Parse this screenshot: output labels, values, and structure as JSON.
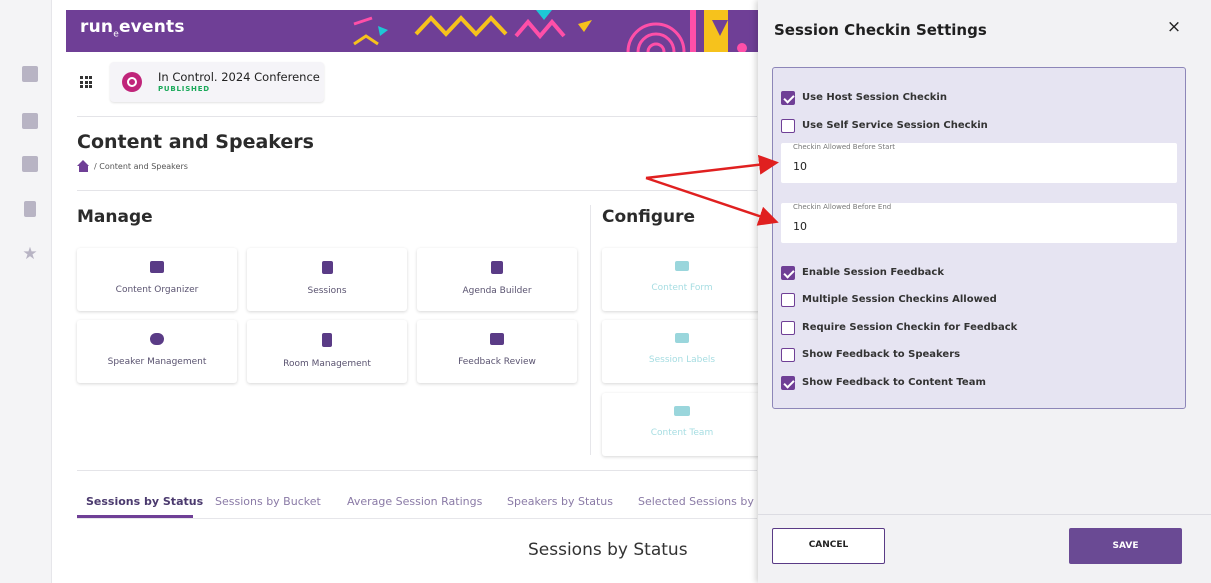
{
  "app": {
    "logo_text": "run",
    "logo_sub": "e",
    "logo_text2": "events"
  },
  "event": {
    "name": "In Control. 2024 Conference",
    "status": "PUBLISHED"
  },
  "page": {
    "title": "Content and Speakers",
    "breadcrumb": "/ Content and Speakers"
  },
  "manage": {
    "title": "Manage",
    "tiles": [
      {
        "label": "Content Organizer",
        "icon": "graduation-cap-icon"
      },
      {
        "label": "Sessions",
        "icon": "list-box-icon"
      },
      {
        "label": "Agenda Builder",
        "icon": "calendar-icon"
      },
      {
        "label": "Speaker Management",
        "icon": "people-icon"
      },
      {
        "label": "Room Management",
        "icon": "door-icon"
      },
      {
        "label": "Feedback Review",
        "icon": "chat-icon"
      }
    ]
  },
  "configure": {
    "title": "Configure",
    "tiles": [
      {
        "label": "Content Form",
        "icon": "list-icon"
      },
      {
        "label": "Session Labels",
        "icon": "label-icon"
      },
      {
        "label": "Content Team",
        "icon": "team-icon"
      }
    ]
  },
  "tabs": [
    "Sessions by Status",
    "Sessions by Bucket",
    "Average Session Ratings",
    "Speakers by Status",
    "Selected Sessions by L"
  ],
  "chart_heading": "Sessions by Status",
  "panel": {
    "title": "Session Checkin Settings",
    "close": "×",
    "options": [
      {
        "label": "Use Host Session Checkin",
        "checked": true
      },
      {
        "label": "Use Self Service Session Checkin",
        "checked": false
      },
      {
        "label": "Enable Session Feedback",
        "checked": true
      },
      {
        "label": "Multiple Session Checkins Allowed",
        "checked": false
      },
      {
        "label": "Require Session Checkin for Feedback",
        "checked": false
      },
      {
        "label": "Show Feedback to Speakers",
        "checked": false
      },
      {
        "label": "Show Feedback to Content Team",
        "checked": true
      }
    ],
    "fields": [
      {
        "label": "Checkin Allowed Before Start",
        "value": "10"
      },
      {
        "label": "Checkin Allowed Before End",
        "value": "10"
      }
    ],
    "cancel_label": "CANCEL",
    "save_label": "SAVE"
  },
  "colors": {
    "brand": "#6f3f96",
    "accent_red": "#e02020",
    "published": "#1aa95a"
  }
}
